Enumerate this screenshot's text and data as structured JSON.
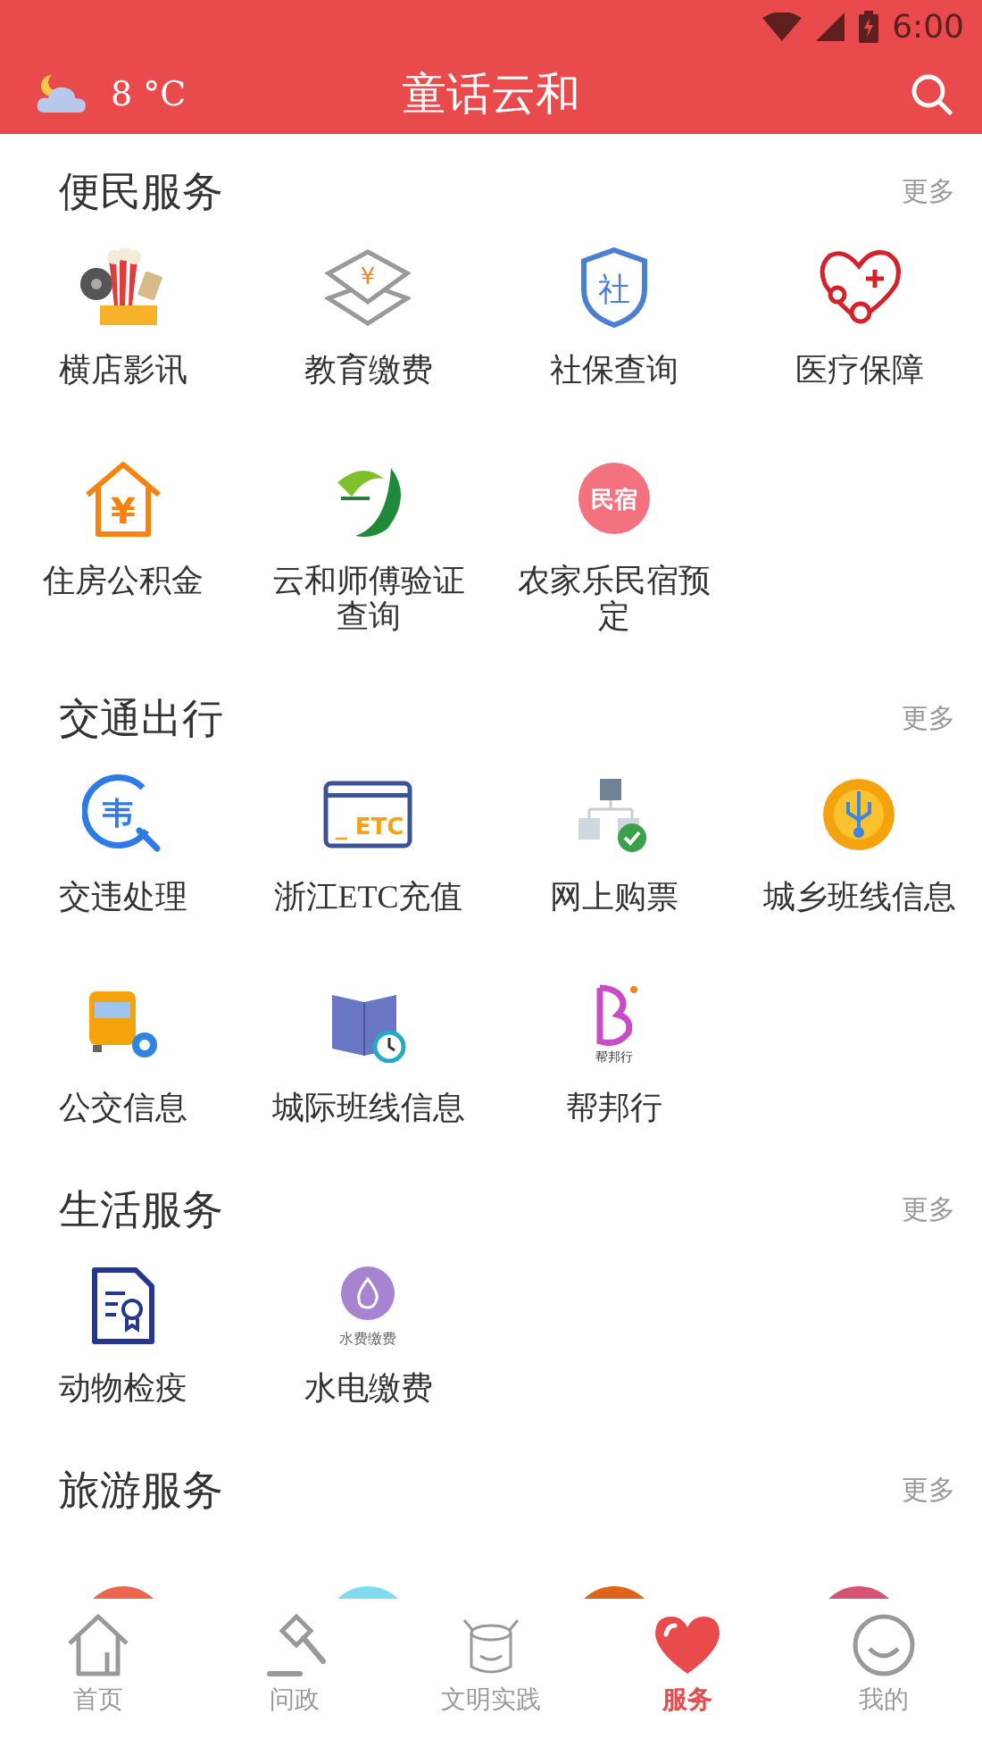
{
  "status_bar": {
    "time": "6:00"
  },
  "header": {
    "temperature": "8 °C",
    "title": "童话云和"
  },
  "sections": [
    {
      "title": "便民服务",
      "more": "更多",
      "items": [
        {
          "label": "横店影讯",
          "kind": "cinema"
        },
        {
          "label": "教育缴费",
          "kind": "yuan-stack",
          "icon_text": "¥"
        },
        {
          "label": "社保查询",
          "kind": "shield",
          "icon_text": "社"
        },
        {
          "label": "医疗保障",
          "kind": "heart-health"
        },
        {
          "label": "住房公积金",
          "kind": "house-yuan",
          "icon_text": "¥"
        },
        {
          "label": "云和师傅验证查询",
          "kind": "leaf-logo"
        },
        {
          "label": "农家乐民宿预定",
          "kind": "text-circle",
          "icon_text": "民宿"
        }
      ]
    },
    {
      "title": "交通出行",
      "more": "更多",
      "items": [
        {
          "label": "交违处理",
          "kind": "search-violation",
          "icon_text": "韦"
        },
        {
          "label": "浙江ETC充值",
          "kind": "etc-card",
          "icon_text": "_ ETC"
        },
        {
          "label": "网上购票",
          "kind": "network-check"
        },
        {
          "label": "城乡班线信息",
          "kind": "usb-circle"
        },
        {
          "label": "公交信息",
          "kind": "bus-gear"
        },
        {
          "label": "城际班线信息",
          "kind": "map-clock"
        },
        {
          "label": "帮邦行",
          "kind": "b-logo",
          "icon_text": "帮邦行"
        }
      ]
    },
    {
      "title": "生活服务",
      "more": "更多",
      "items": [
        {
          "label": "动物检疫",
          "kind": "document-seal"
        },
        {
          "label": "水电缴费",
          "kind": "drop-circle",
          "icon_text": "水费缴费"
        }
      ]
    },
    {
      "title": "旅游服务",
      "more": "更多",
      "items": [
        {
          "kind": "palm-circle",
          "color": "#ee6552"
        },
        {
          "kind": "scenery-circle",
          "color": "#7fdbef"
        },
        {
          "kind": "ornament-circle",
          "color": "#e0641a"
        },
        {
          "kind": "fork-circle",
          "color": "#d95175"
        }
      ]
    }
  ],
  "nav": [
    {
      "label": "首页",
      "kind": "home",
      "selected": false
    },
    {
      "label": "问政",
      "kind": "gavel",
      "selected": false
    },
    {
      "label": "文明实践",
      "kind": "mascot",
      "selected": false
    },
    {
      "label": "服务",
      "kind": "heart",
      "selected": true
    },
    {
      "label": "我的",
      "kind": "smile",
      "selected": false
    }
  ]
}
